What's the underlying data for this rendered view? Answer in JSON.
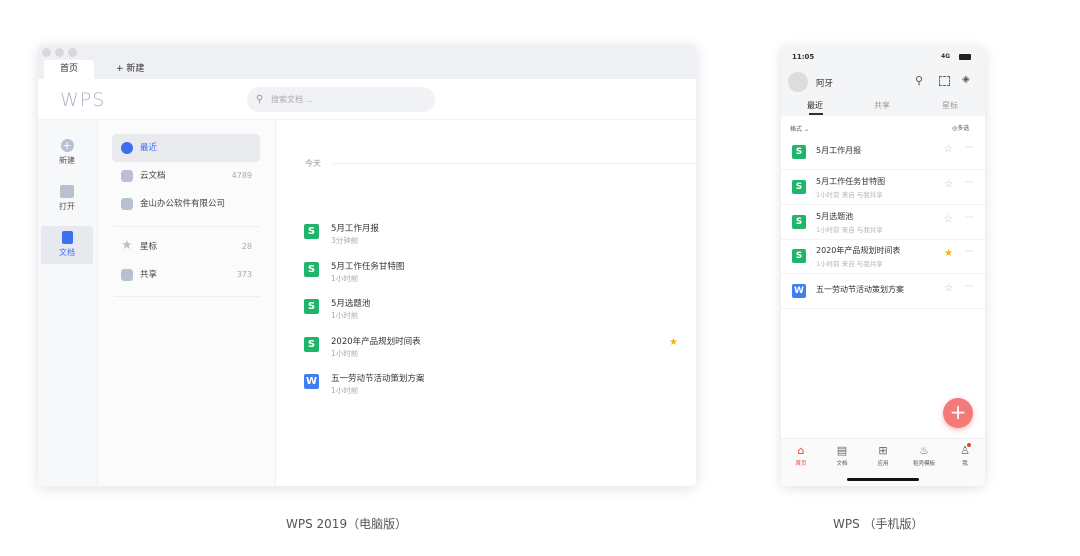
{
  "desktop": {
    "tabs": [
      "首页",
      "新建"
    ],
    "logo": "WPS",
    "search_placeholder": "搜索文档 ...",
    "rail": [
      {
        "label": "新建",
        "icon": "plus-circle-icon"
      },
      {
        "label": "打开",
        "icon": "folder-icon"
      },
      {
        "label": "文档",
        "icon": "document-icon"
      }
    ],
    "nav": [
      {
        "label": "最近",
        "count": ""
      },
      {
        "label": "云文档",
        "count": "4789"
      },
      {
        "label": "金山办公软件有限公司",
        "count": ""
      },
      {
        "label": "星标",
        "count": "28"
      },
      {
        "label": "共享",
        "count": "373"
      }
    ],
    "section": "今天",
    "files": [
      {
        "name": "5月工作月报",
        "time": "3分钟前",
        "type": "S",
        "starred": false
      },
      {
        "name": "5月工作任务甘特图",
        "time": "1小时前",
        "type": "S",
        "starred": false
      },
      {
        "name": "5月选题池",
        "time": "1小时前",
        "type": "S",
        "starred": false
      },
      {
        "name": "2020年产品规划时间表",
        "time": "1小时前",
        "type": "S",
        "starred": true
      },
      {
        "name": "五一劳动节活动策划方案",
        "time": "1小时前",
        "type": "W",
        "starred": false
      }
    ],
    "caption": "WPS 2019（电脑版）"
  },
  "mobile": {
    "status_time": "11:05",
    "status_network": "4G",
    "user": "阿牙",
    "tabs": [
      "最近",
      "共享",
      "星标"
    ],
    "filter": "格式",
    "multi_select": "多选",
    "files": [
      {
        "name": "5月工作月报",
        "meta": "",
        "type": "S",
        "starred": false
      },
      {
        "name": "5月工作任务甘特图",
        "meta": "1小时前    来自 与我共享",
        "type": "S",
        "starred": false
      },
      {
        "name": "5月选题池",
        "meta": "1小时前    来自 与我共享",
        "type": "S",
        "starred": false
      },
      {
        "name": "2020年产品规划时间表",
        "meta": "1小时前    来自 与我共享",
        "type": "S",
        "starred": true
      },
      {
        "name": "五一劳动节活动策划方案",
        "meta": "",
        "type": "W",
        "starred": false
      }
    ],
    "tabbar": [
      "首页",
      "文档",
      "应用",
      "稻壳模板",
      "我"
    ],
    "caption": "WPS （手机版）"
  },
  "colors": {
    "sheet": "#1fb56a",
    "writer": "#3f7ef1",
    "accent": "#3d6ff0",
    "fab": "#f47a7a",
    "star": "#f5b400"
  }
}
